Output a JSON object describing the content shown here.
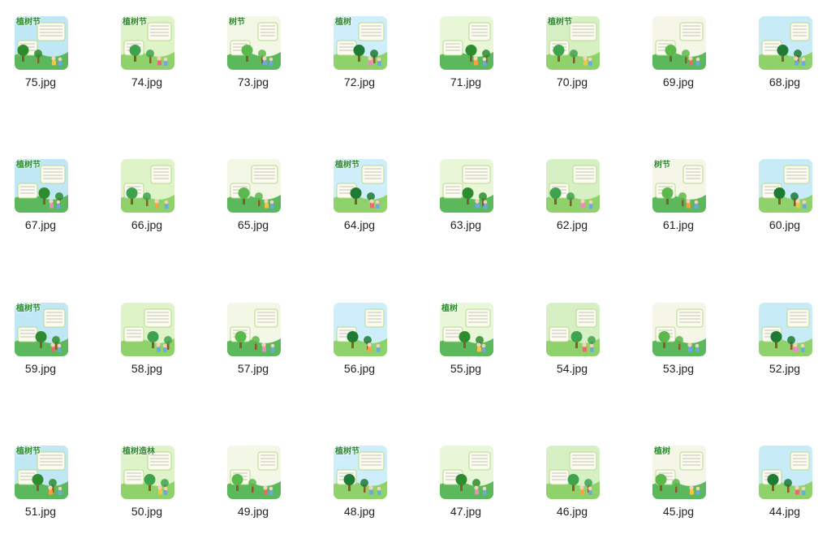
{
  "files": [
    {
      "name": "75.jpg",
      "title": "植树节"
    },
    {
      "name": "74.jpg",
      "title": "植树节"
    },
    {
      "name": "73.jpg",
      "title": "树节"
    },
    {
      "name": "72.jpg",
      "title": "植树"
    },
    {
      "name": "71.jpg",
      "title": ""
    },
    {
      "name": "70.jpg",
      "title": "植树节"
    },
    {
      "name": "69.jpg",
      "title": ""
    },
    {
      "name": "68.jpg",
      "title": ""
    },
    {
      "name": "67.jpg",
      "title": "植树节"
    },
    {
      "name": "66.jpg",
      "title": ""
    },
    {
      "name": "65.jpg",
      "title": ""
    },
    {
      "name": "64.jpg",
      "title": "植树节"
    },
    {
      "name": "63.jpg",
      "title": ""
    },
    {
      "name": "62.jpg",
      "title": ""
    },
    {
      "name": "61.jpg",
      "title": "树节"
    },
    {
      "name": "60.jpg",
      "title": ""
    },
    {
      "name": "59.jpg",
      "title": "植树节"
    },
    {
      "name": "58.jpg",
      "title": ""
    },
    {
      "name": "57.jpg",
      "title": ""
    },
    {
      "name": "56.jpg",
      "title": ""
    },
    {
      "name": "55.jpg",
      "title": "植树"
    },
    {
      "name": "54.jpg",
      "title": ""
    },
    {
      "name": "53.jpg",
      "title": ""
    },
    {
      "name": "52.jpg",
      "title": ""
    },
    {
      "name": "51.jpg",
      "title": "植树节"
    },
    {
      "name": "50.jpg",
      "title": "植树造林"
    },
    {
      "name": "49.jpg",
      "title": ""
    },
    {
      "name": "48.jpg",
      "title": "植树节"
    },
    {
      "name": "47.jpg",
      "title": ""
    },
    {
      "name": "46.jpg",
      "title": ""
    },
    {
      "name": "45.jpg",
      "title": "植树"
    },
    {
      "name": "44.jpg",
      "title": ""
    }
  ],
  "colors": {
    "text": "#222222",
    "background": "#ffffff",
    "green_dark": "#2e8b2e",
    "green_light": "#a8dc7a",
    "sky": "#9ed8f0",
    "paper": "#fbfbf2"
  }
}
